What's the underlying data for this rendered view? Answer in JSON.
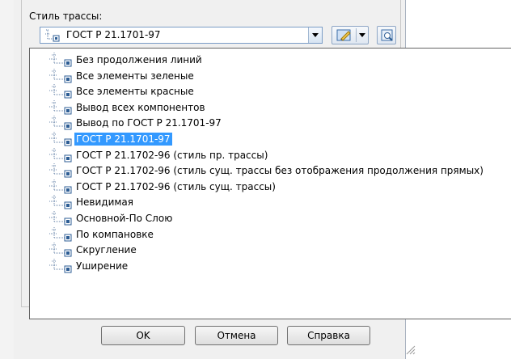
{
  "style_field": {
    "label": "Стиль трассы:",
    "selected_value": "ГОСТ Р 21.1701-97",
    "icon": "tree-node-icon"
  },
  "toolbar": {
    "edit_button_icon": "edit-style-icon",
    "view_button_icon": "view-details-icon"
  },
  "dropdown": {
    "items": [
      {
        "label": "Без продолжения линий",
        "selected": false
      },
      {
        "label": "Все элементы зеленые",
        "selected": false
      },
      {
        "label": "Все элементы красные",
        "selected": false
      },
      {
        "label": "Вывод всех компонентов",
        "selected": false
      },
      {
        "label": "Вывод по ГОСТ Р 21.1701-97",
        "selected": false
      },
      {
        "label": "ГОСТ Р 21.1701-97",
        "selected": true
      },
      {
        "label": "ГОСТ Р 21.1702-96 (стиль пр. трассы)",
        "selected": false
      },
      {
        "label": "ГОСТ Р 21.1702-96 (стиль сущ. трассы без отображения продолжения прямых)",
        "selected": false
      },
      {
        "label": "ГОСТ Р 21.1702-96 (стиль сущ. трассы)",
        "selected": false
      },
      {
        "label": "Невидимая",
        "selected": false
      },
      {
        "label": "Основной-По Слою",
        "selected": false
      },
      {
        "label": "По компановке",
        "selected": false
      },
      {
        "label": "Скругление",
        "selected": false
      },
      {
        "label": "Уширение",
        "selected": false
      }
    ]
  },
  "buttons": {
    "ok": "OK",
    "cancel": "Отмена",
    "help": "Справка"
  },
  "colors": {
    "selection": "#3399ff",
    "dialog_bg": "#f0f0f0"
  }
}
